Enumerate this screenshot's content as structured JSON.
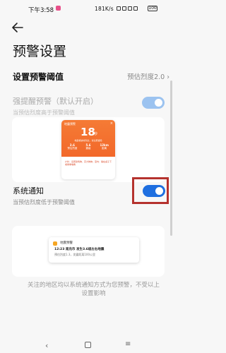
{
  "status_bar": {
    "time": "下午3:58",
    "network_speed": "181K/s",
    "battery": "100"
  },
  "header": {
    "title": "预警设置"
  },
  "threshold": {
    "label": "设置预警阈值",
    "value": "预估烈度2.0"
  },
  "strong_alert": {
    "title": "强提醒预警（默认开启）",
    "subtitle": "当预估烈度高于预警阈值",
    "enabled": true,
    "disabled": true
  },
  "alert_preview": {
    "header_text": "地震预警",
    "big_number": "18",
    "unit": "秒",
    "description": "地震横波将到达，请注意避险",
    "stats": [
      {
        "value": "3.6",
        "label": "预估烈度"
      },
      {
        "value": "5.6",
        "label": "震级"
      },
      {
        "value": "12km",
        "label": "距离"
      }
    ],
    "footer": "户外：远离建筑物、高大物体；室内：躲在桌子下或承重墙角"
  },
  "system_notification": {
    "title": "系统通知",
    "subtitle": "当预估烈度低于预警阈值",
    "enabled": true
  },
  "notification_preview": {
    "app_name": "地震预警",
    "line1": "12:23 南充市 发生3.6级左右地震",
    "line2": "预估烈度1.3，发震距离100公里"
  },
  "footer_note": "关注的地区均以系统通知方式为您预警，不受以上设置影响",
  "colors": {
    "accent": "#1f6fe0",
    "accent_disabled": "#9cc3f0",
    "alert_orange": "#f2682a",
    "highlight_border": "#b5322e"
  },
  "icons": {
    "back": "back-arrow-icon",
    "nav_back": "chevron-left-icon",
    "nav_home": "square-icon",
    "nav_menu": "menu-icon"
  }
}
